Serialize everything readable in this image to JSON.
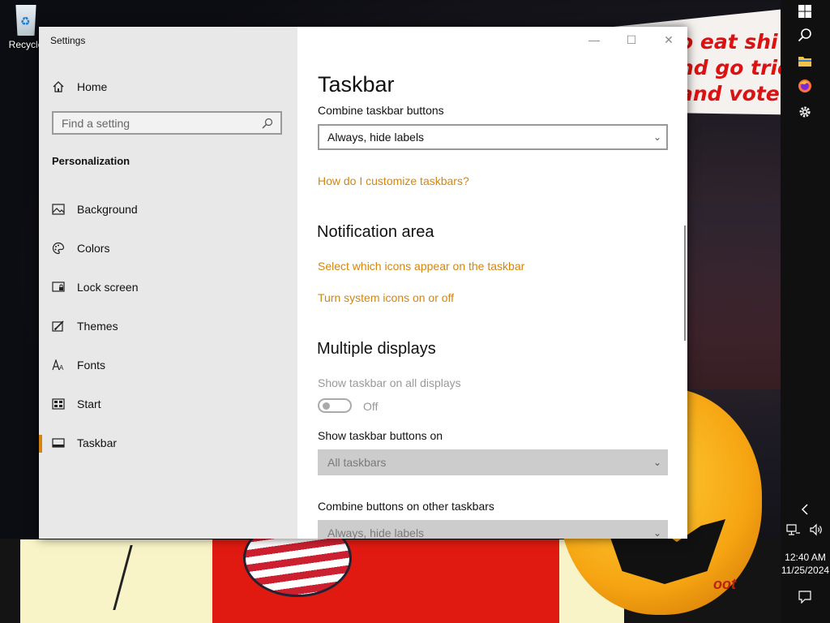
{
  "desktop": {
    "recycle_bin_label": "Recycle",
    "wallpaper_text": [
      "o eat shi",
      "nd go trick",
      "and vote!"
    ],
    "wallpaper_bottom": "oot"
  },
  "window": {
    "title": "Settings",
    "controls": {
      "minimize": "—",
      "maximize": "☐",
      "close": "✕"
    }
  },
  "sidebar": {
    "home_label": "Home",
    "search_placeholder": "Find a setting",
    "section": "Personalization",
    "items": [
      {
        "label": "Background",
        "icon": "picture-icon"
      },
      {
        "label": "Colors",
        "icon": "palette-icon"
      },
      {
        "label": "Lock screen",
        "icon": "lock-screen-icon"
      },
      {
        "label": "Themes",
        "icon": "brush-icon"
      },
      {
        "label": "Fonts",
        "icon": "fonts-icon"
      },
      {
        "label": "Start",
        "icon": "start-icon"
      },
      {
        "label": "Taskbar",
        "icon": "taskbar-icon",
        "active": true
      }
    ]
  },
  "main": {
    "page_title": "Taskbar",
    "combine_label": "Combine taskbar buttons",
    "combine_value": "Always, hide labels",
    "help_link": "How do I customize taskbars?",
    "notification_title": "Notification area",
    "notification_links": [
      "Select which icons appear on the taskbar",
      "Turn system icons on or off"
    ],
    "multiple_title": "Multiple displays",
    "show_all_label": "Show taskbar on all displays",
    "show_all_state": "Off",
    "show_buttons_label": "Show taskbar buttons on",
    "show_buttons_value": "All taskbars",
    "combine_other_label": "Combine buttons on other taskbars",
    "combine_other_value": "Always, hide labels"
  },
  "taskbar": {
    "time": "12:40 AM",
    "date": "11/25/2024"
  },
  "colors": {
    "accent": "#d4860f",
    "sidebar_bg": "#e8e8e8",
    "taskbar_bg": "#101010"
  }
}
